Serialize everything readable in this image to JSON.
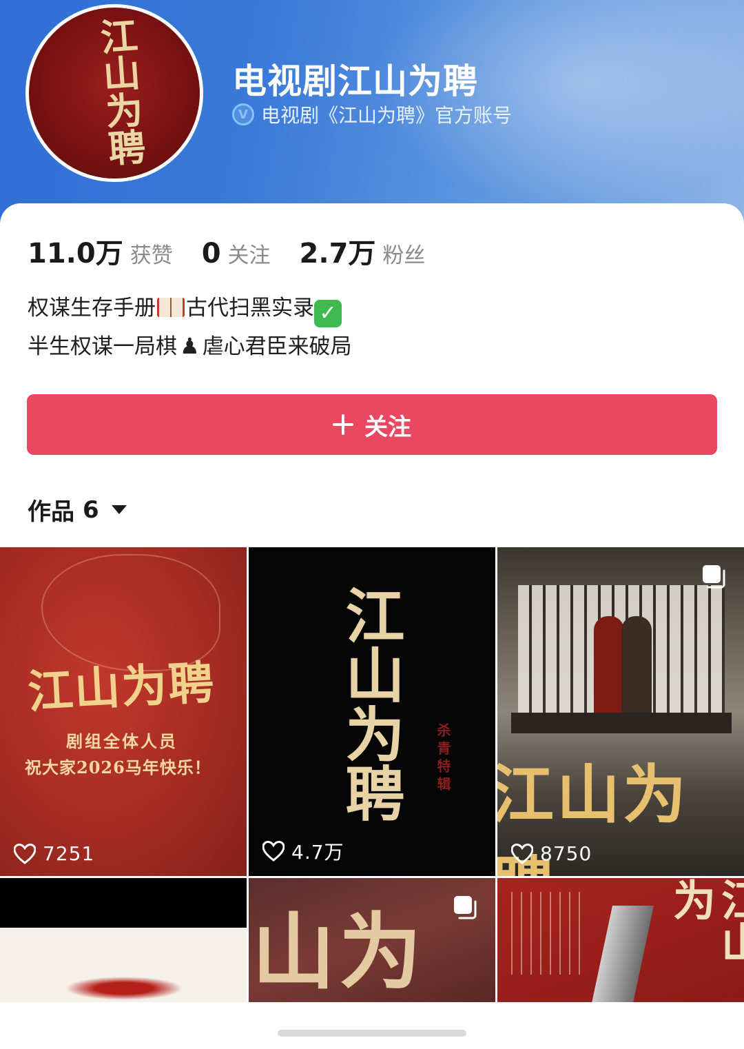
{
  "profile": {
    "name": "电视剧江山为聘",
    "verified_text": "电视剧《江山为聘》官方账号",
    "avatar_text": "江山为聘"
  },
  "stats": [
    {
      "num": "11.0万",
      "label": "获赞"
    },
    {
      "num": "0",
      "label": "关注"
    },
    {
      "num": "2.7万",
      "label": "粉丝"
    }
  ],
  "bio": {
    "line1_a": "权谋生存手册",
    "line1_b": "古代扫黑实录",
    "line2_a": "半生权谋一局棋",
    "line2_b": "虐心君臣来破局"
  },
  "follow_button": {
    "label": "关注"
  },
  "works": {
    "label": "作品",
    "count": "6"
  },
  "posts": [
    {
      "likes": "7251",
      "title": "江山为聘",
      "line1": "剧组全体人员",
      "line2": "祝大家2026马年快乐！"
    },
    {
      "likes": "4.7万",
      "title": "江山为聘",
      "side": "杀青特辑"
    },
    {
      "likes": "8750",
      "title": "江山为聘"
    },
    {},
    {
      "title": "山为"
    },
    {
      "title": "江山为"
    }
  ],
  "colors": {
    "accent": "#e84860",
    "header": "#3a7ad9"
  }
}
